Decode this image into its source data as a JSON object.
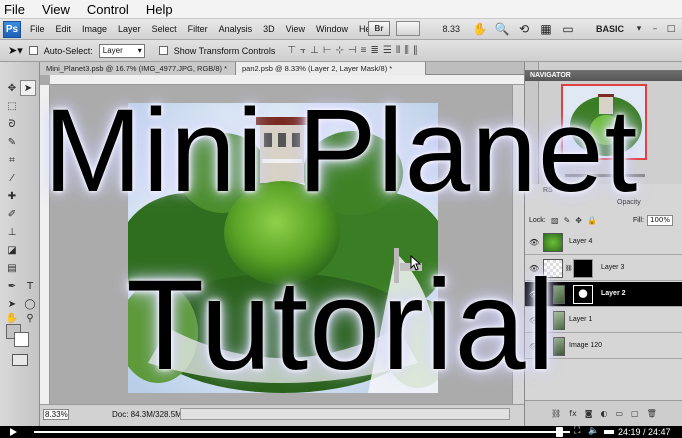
{
  "player_menu": {
    "file": "File",
    "view": "View",
    "control": "Control",
    "help": "Help"
  },
  "app": {
    "logo": "Ps",
    "menu": [
      "File",
      "Edit",
      "Image",
      "Layer",
      "Select",
      "Filter",
      "Analysis",
      "3D",
      "View",
      "Window",
      "Help"
    ],
    "bridge_label": "Br",
    "zoom_value": "8.33",
    "workspace": "BASIC",
    "window_buttons": [
      "▾",
      "–",
      "□"
    ]
  },
  "options": {
    "auto_select_label": "Auto-Select:",
    "auto_select_value": "Layer",
    "show_transform_label": "Show Transform Controls"
  },
  "documents": {
    "tab1": "Mini_Planet3.psb @ 16.7% (IMG_4977.JPG, RGB/8) *",
    "tab2": "pan2.psb @ 8.33% (Layer 2, Layer Mask/8) *",
    "status_zoom": "8.33%",
    "status_doc": "Doc: 84.3M/328.5M"
  },
  "panels": {
    "navigator": "NAVIGATOR",
    "layers_tab": "RS",
    "opacity_label": "Opacity",
    "lock_label": "Lock:",
    "fill_label": "Fill:",
    "fill_value": "100%",
    "layers": [
      {
        "name": "Layer 4",
        "selected": false
      },
      {
        "name": "Layer 3",
        "selected": false
      },
      {
        "name": "Layer 2",
        "selected": true
      },
      {
        "name": "Layer 1",
        "selected": false
      },
      {
        "name": "Image 120",
        "selected": false
      }
    ]
  },
  "overlay": {
    "line1": "Mini Planet",
    "line2": "Tutorial"
  },
  "player": {
    "time": "24:19 / 24:47",
    "progress": 0.98
  },
  "colors": {
    "selected_layer": "#000000",
    "sky": "#dde8f5",
    "grass": "#5aa326",
    "foliage": "#2f6d1f"
  }
}
